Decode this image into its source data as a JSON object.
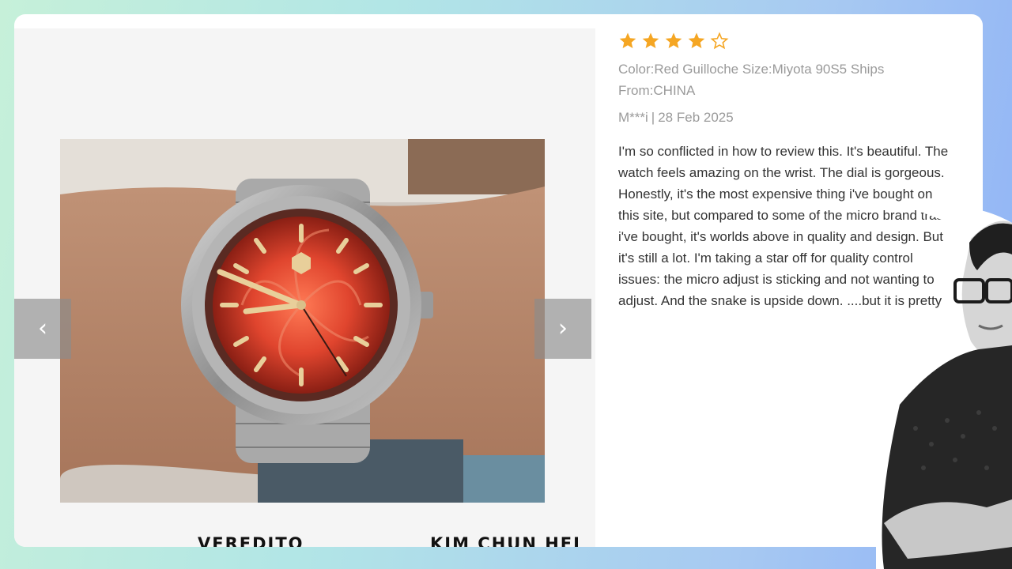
{
  "gallery": {
    "prev_icon": "chevron-left-icon",
    "next_icon": "chevron-right-icon",
    "prev_glyph": "‹",
    "next_glyph": "›"
  },
  "captions": {
    "left": "VEREDITO",
    "right": "KIM CHUN HEI"
  },
  "review": {
    "rating": 4,
    "max_rating": 5,
    "star_color": "#f5a623",
    "meta_line1": "Color:Red Guilloche Size:Miyota 90S5 Ships",
    "meta_line2": "From:CHINA",
    "author": "M***i",
    "date": "28 Feb 2025",
    "body_lines": [
      "I'm so conflicted in how to review this. It's beautiful. The",
      "watch feels amazing on the wrist. The dial is gorgeous.",
      "Honestly, it's the most expensive thing i've bought on",
      "this site, but compared to some of the micro brand trash",
      "i've bought, it's worlds above in quality and design. But",
      "it's still a lot. I'm taking a star off for quality control",
      "issues: the micro adjust is sticking and not wanting to",
      "adjust. And the snake is upside down. ....but it is pretty"
    ]
  }
}
